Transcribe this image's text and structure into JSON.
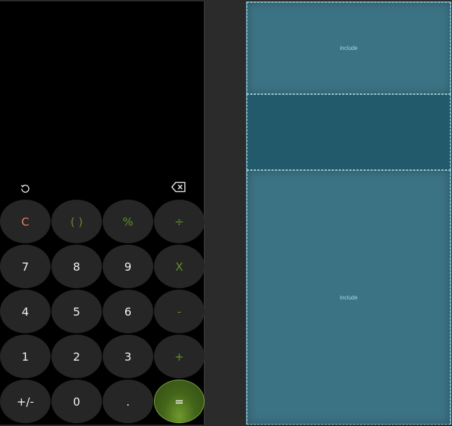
{
  "design_preview": {
    "history_icon": "history-icon",
    "backspace_icon": "backspace-icon",
    "keys": [
      {
        "label": "C",
        "kind": "clear"
      },
      {
        "label": "( )",
        "kind": "op"
      },
      {
        "label": "%",
        "kind": "op"
      },
      {
        "label": "÷",
        "kind": "op"
      },
      {
        "label": "7",
        "kind": "num"
      },
      {
        "label": "8",
        "kind": "num"
      },
      {
        "label": "9",
        "kind": "num"
      },
      {
        "label": "X",
        "kind": "op"
      },
      {
        "label": "4",
        "kind": "num"
      },
      {
        "label": "5",
        "kind": "num"
      },
      {
        "label": "6",
        "kind": "num"
      },
      {
        "label": "-",
        "kind": "op"
      },
      {
        "label": "1",
        "kind": "num"
      },
      {
        "label": "2",
        "kind": "num"
      },
      {
        "label": "3",
        "kind": "num"
      },
      {
        "label": "+",
        "kind": "op"
      },
      {
        "label": "+/-",
        "kind": "num"
      },
      {
        "label": "0",
        "kind": "num"
      },
      {
        "label": ".",
        "kind": "num"
      },
      {
        "label": "=",
        "kind": "eq"
      }
    ]
  },
  "blueprint": {
    "top_label": "include",
    "bottom_label": "include"
  },
  "colors": {
    "design_background": "#000000",
    "key_background": "#262626",
    "clear_key_text": "#e0805a",
    "operator_key_text": "#5f8f2a",
    "equals_key_background": "#4f7520",
    "blueprint_background": "#3d7283",
    "blueprint_highlight": "#235a6b"
  }
}
